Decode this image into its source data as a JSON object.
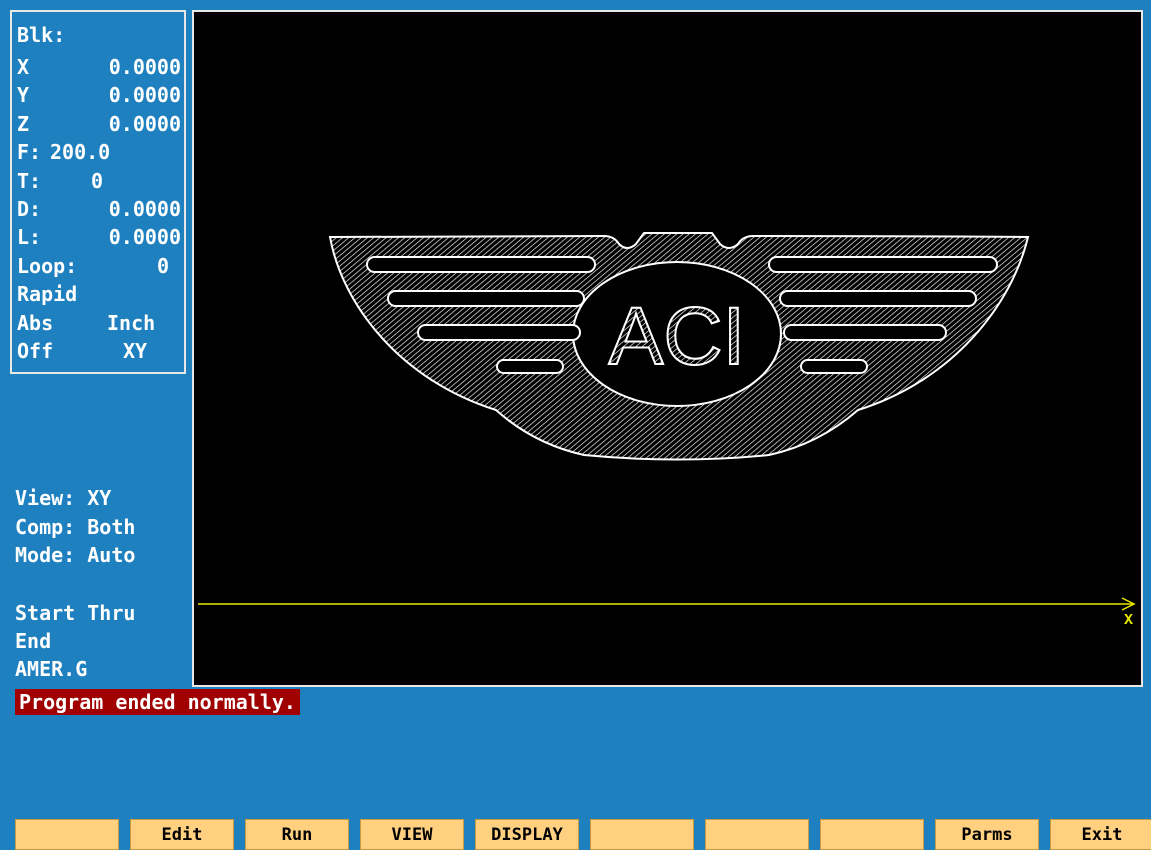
{
  "status": {
    "blk_label": "Blk:",
    "x_label": "X",
    "x_value": "0.0000",
    "y_label": "Y",
    "y_value": "0.0000",
    "z_label": "Z",
    "z_value": "0.0000",
    "f_label": "F:",
    "f_value": "200.0",
    "t_label": "T:",
    "t_value": "0",
    "d_label": "D:",
    "d_value": "0.0000",
    "l_label": "L:",
    "l_value": "0.0000",
    "loop_label": "Loop:",
    "loop_value": "0",
    "motion": "Rapid",
    "positioning": "Abs",
    "units": "Inch",
    "state": "Off",
    "plane": "XY"
  },
  "view_info": {
    "view": "View: XY",
    "comp": "Comp: Both",
    "mode": "Mode: Auto",
    "start_thru": "Start Thru",
    "end": "End",
    "filename": "AMER.G"
  },
  "viewport": {
    "logo_text": "ACI",
    "axis_label": "X",
    "axis_color": "#e8e800"
  },
  "message": "Program ended normally.",
  "softkeys": [
    "",
    "Edit",
    "Run",
    "VIEW",
    "DISPLAY",
    "",
    "",
    "",
    "Parms",
    "Exit"
  ],
  "colors": {
    "background": "#1f80c0",
    "viewport": "#000000",
    "softkey": "#ffd080",
    "message_bar": "#a00000"
  }
}
